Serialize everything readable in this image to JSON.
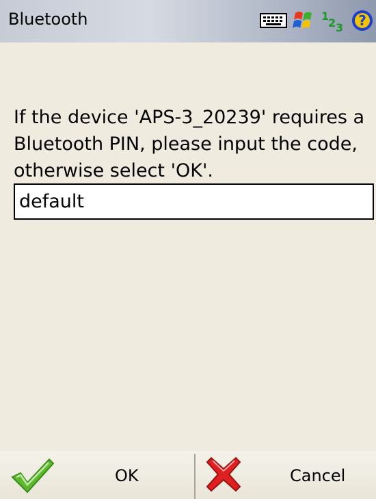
{
  "titlebar": {
    "title": "Bluetooth",
    "tray_icons": [
      "keyboard-icon",
      "windows-start-icon",
      "input-mode-123-icon",
      "help-icon"
    ],
    "input_mode_text": "123"
  },
  "dialog": {
    "message": "If the device 'APS-3_20239' requires a Bluetooth PIN, please input the code, otherwise select 'OK'.",
    "pin_value": "default"
  },
  "softkeys": {
    "ok_label": "OK",
    "cancel_label": "Cancel",
    "ok_icon": "green-checkmark-icon",
    "cancel_icon": "red-x-icon"
  },
  "colors": {
    "background": "#efebde",
    "ok_green": "#5cb82e",
    "cancel_red": "#e02020",
    "help_blue": "#1e3fd0"
  }
}
